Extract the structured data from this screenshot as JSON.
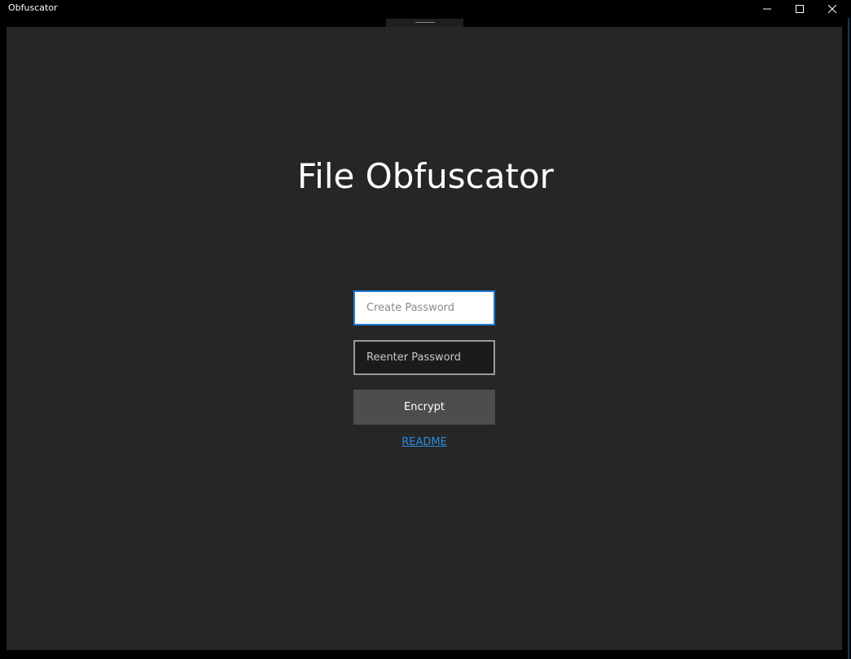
{
  "window": {
    "title": "Obfuscator",
    "controls": {
      "minimize_icon": "minimize-icon",
      "maximize_icon": "maximize-icon",
      "close_icon": "close-icon"
    }
  },
  "main": {
    "heading": "File Obfuscator",
    "create_password": {
      "placeholder": "Create Password",
      "value": ""
    },
    "reenter_password": {
      "placeholder": "Reenter Password",
      "value": ""
    },
    "encrypt_label": "Encrypt",
    "readme_label": "README"
  },
  "colors": {
    "background": "#262626",
    "titlebar": "#000000",
    "focus_border": "#1e7fd8",
    "button": "#4d4d4d",
    "link": "#2a8be0"
  }
}
